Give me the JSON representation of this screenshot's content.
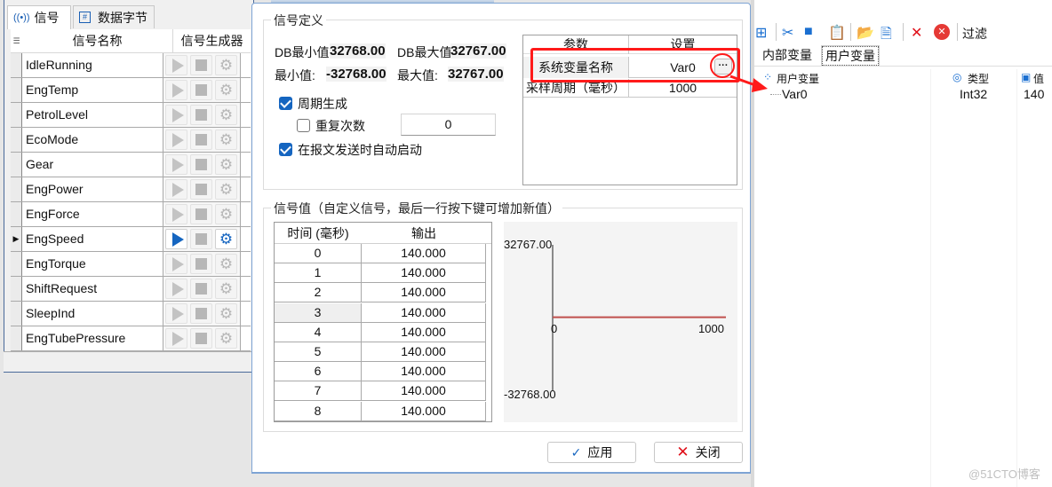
{
  "left": {
    "tabs": [
      {
        "label": "信号",
        "icon": "broadcast-icon",
        "active": true
      },
      {
        "label": "数据字节",
        "icon": "hash-icon",
        "active": false
      }
    ],
    "columns": [
      "信号名称",
      "信号生成器"
    ],
    "signals": [
      {
        "name": "IdleRunning",
        "active": false
      },
      {
        "name": "EngTemp",
        "active": false
      },
      {
        "name": "PetrolLevel",
        "active": false
      },
      {
        "name": "EcoMode",
        "active": false
      },
      {
        "name": "Gear",
        "active": false
      },
      {
        "name": "EngPower",
        "active": false
      },
      {
        "name": "EngForce",
        "active": false
      },
      {
        "name": "EngSpeed",
        "active": true
      },
      {
        "name": "EngTorque",
        "active": false
      },
      {
        "name": "ShiftRequest",
        "active": false
      },
      {
        "name": "SleepInd",
        "active": false
      },
      {
        "name": "EngTubePressure",
        "active": false
      }
    ]
  },
  "dialog": {
    "definition": {
      "title": "信号定义",
      "db_min_label": "DB最小值",
      "db_min_value": "32768.00",
      "db_max_label": "DB最大值",
      "db_max_value": "32767.00",
      "min_label": "最小值:",
      "min_value": "-32768.00",
      "max_label": "最大值:",
      "max_value": "32767.00",
      "periodic_label": "周期生成",
      "periodic_checked": true,
      "repeat_label": "重复次数",
      "repeat_checked": false,
      "repeat_value": "0",
      "autostart_label": "在报文发送时自动启动",
      "autostart_checked": true
    },
    "params": {
      "headers": [
        "参数",
        "设置"
      ],
      "rows": [
        {
          "param": "系统变量名称",
          "value": "Var0",
          "has_button": true,
          "button_label": "···"
        },
        {
          "param": "采样周期（毫秒）",
          "value": "1000"
        }
      ]
    },
    "values": {
      "title": "信号值（自定义信号，最后一行按下键可增加新值）",
      "headers": [
        "时间 (毫秒)",
        "输出"
      ],
      "rows": [
        {
          "t": "0",
          "out": "140.000"
        },
        {
          "t": "1",
          "out": "140.000"
        },
        {
          "t": "2",
          "out": "140.000"
        },
        {
          "t": "3",
          "out": "140.000"
        },
        {
          "t": "4",
          "out": "140.000"
        },
        {
          "t": "5",
          "out": "140.000"
        },
        {
          "t": "6",
          "out": "140.000"
        },
        {
          "t": "7",
          "out": "140.000"
        },
        {
          "t": "8",
          "out": "140.000"
        }
      ],
      "highlighted_row": 3
    },
    "chart": {
      "y_max_label": "32767.00",
      "y_min_label": "-32768.00",
      "x_min_label": "0",
      "x_max_label": "1000",
      "y_range": [
        -32768,
        32767
      ],
      "x_range": [
        0,
        1000
      ],
      "line_value": 140,
      "line_color": "#c0504d"
    },
    "buttons": {
      "apply": "应用",
      "close": "关闭"
    }
  },
  "right": {
    "toolbar": {
      "icons": [
        "add-variable-icon",
        "cut-icon",
        "copy-icon",
        "paste-icon",
        "import-icon",
        "export-icon",
        "delete-icon",
        "delete-all-icon"
      ],
      "filter_label": "过滤"
    },
    "tabs": [
      {
        "label": "内部变量",
        "active": false
      },
      {
        "label": "用户变量",
        "active": true
      }
    ],
    "tree": {
      "headers": [
        "用户变量",
        "类型",
        "值"
      ],
      "root": "用户变量",
      "items": [
        {
          "name": "Var0",
          "type": "Int32",
          "value": "140"
        }
      ]
    }
  },
  "watermark": "@51CTO博客"
}
